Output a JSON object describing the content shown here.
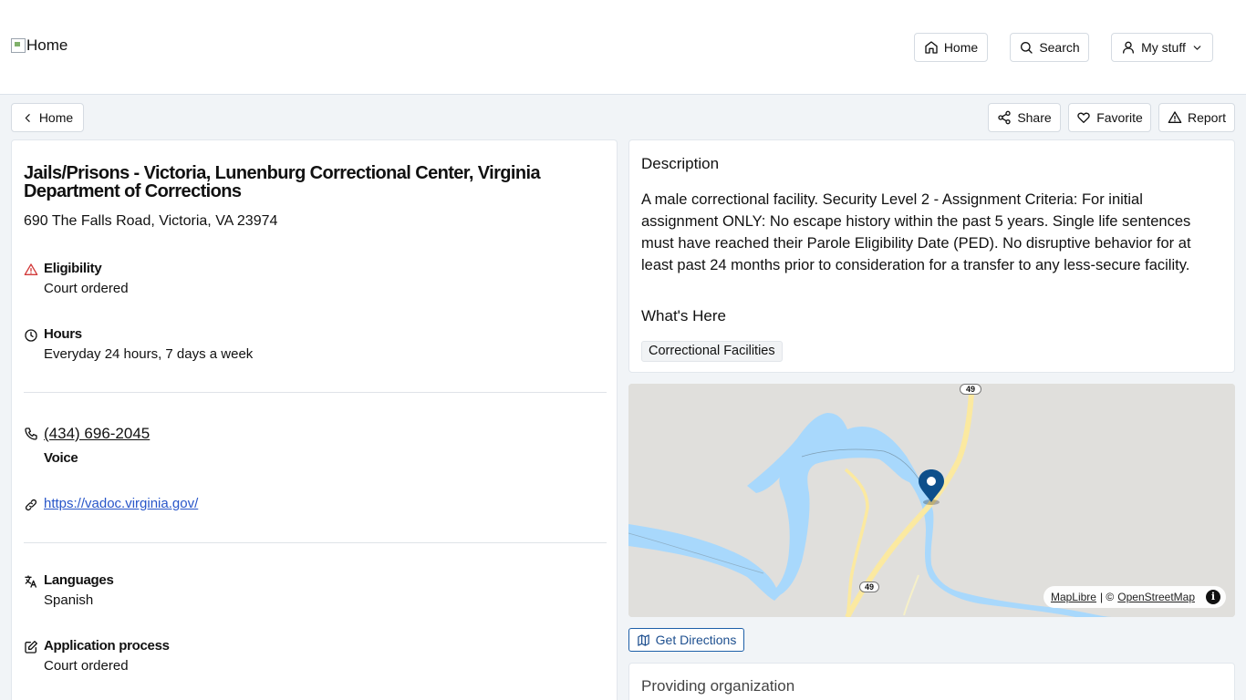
{
  "header": {
    "logo_alt": "Home",
    "nav": {
      "home": "Home",
      "search": "Search",
      "my_stuff": "My stuff"
    }
  },
  "toolbar": {
    "back": "Home",
    "share": "Share",
    "favorite": "Favorite",
    "report": "Report"
  },
  "service": {
    "title": "Jails/Prisons - Victoria, Lunenburg Correctional Center, Virginia Department of Corrections",
    "address": "690 The Falls Road, Victoria, VA 23974",
    "eligibility": {
      "label": "Eligibility",
      "value": "Court ordered"
    },
    "hours": {
      "label": "Hours",
      "value": "Everyday 24 hours, 7 days a week"
    },
    "phone": {
      "number": "(434) 696-2045",
      "type": "Voice"
    },
    "website": "https://vadoc.virginia.gov/",
    "languages": {
      "label": "Languages",
      "value": "Spanish"
    },
    "application": {
      "label": "Application process",
      "value": "Court ordered"
    }
  },
  "description": {
    "heading": "Description",
    "text": "A male correctional facility. Security Level 2 - Assignment Criteria: For initial assignment ONLY: No escape history within the past 5 years. Single life sentences must have reached their Parole Eligibility Date (PED). No disruptive behavior for at least past 24 months prior to consideration for a transfer to any less-secure facility.",
    "whats_here_heading": "What's Here",
    "tags": [
      "Correctional Facilities"
    ]
  },
  "map": {
    "route_shields": [
      "49",
      "49"
    ],
    "attribution": {
      "maplibre": "MapLibre",
      "separator": "| ©",
      "osm": "OpenStreetMap"
    },
    "colors": {
      "water": "#a8d8fc",
      "land": "#e0dfdc",
      "road": "#fbe9a0",
      "pin": "#0d4f8b"
    }
  },
  "directions_label": "Get Directions",
  "org": {
    "heading": "Providing organization"
  }
}
